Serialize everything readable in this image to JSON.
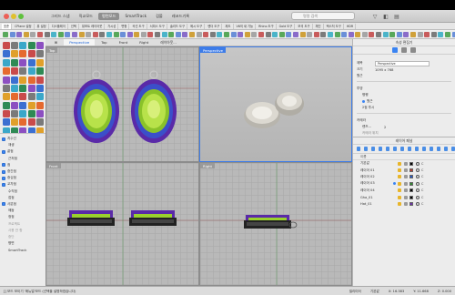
{
  "window": {
    "mode_tabs": [
      "그리드 스냅",
      "직교모드",
      "평면모드",
      "SmartTrack",
      "검볼",
      "레코드기록"
    ],
    "active_mode_index": 2,
    "search_placeholder": "명령 검색"
  },
  "toolbar_tabs": [
    "표준",
    "CPlane 설정",
    "뷰 설정",
    "디스플레이",
    "선택",
    "뷰포트 레이아웃",
    "가시성",
    "변형",
    "곡선 도구",
    "서피스 도구",
    "솔리드 도구",
    "메시 도구",
    "렌더 도구",
    "제도",
    "V6의 새 기능",
    "Rhino 도구",
    "Gold 도구",
    "보석 도구",
    "체인",
    "텍스처 도구",
    "HDR"
  ],
  "active_toolbar_tab_index": 0,
  "viewport_tabs": [
    "Perspective",
    "Top",
    "Front",
    "Right",
    "레이아웃..."
  ],
  "active_viewport_tab_index": 0,
  "viewports": {
    "top": "Top",
    "perspective": "Perspective",
    "front": "Front",
    "right": "Right"
  },
  "left_panel": {
    "items": [
      {
        "label": "치수선",
        "checked": true,
        "indent": false,
        "dim": false
      },
      {
        "label": "재생",
        "checked": false,
        "indent": true,
        "dim": false
      },
      {
        "label": "끝점",
        "checked": true,
        "indent": false,
        "dim": false
      },
      {
        "label": "근처점",
        "checked": false,
        "indent": true,
        "dim": false
      },
      {
        "label": "점",
        "checked": true,
        "indent": false,
        "dim": false
      },
      {
        "label": "중간점",
        "checked": true,
        "indent": false,
        "dim": false
      },
      {
        "label": "중심점",
        "checked": true,
        "indent": false,
        "dim": false
      },
      {
        "label": "교차점",
        "checked": true,
        "indent": false,
        "dim": false
      },
      {
        "label": "수직점",
        "checked": false,
        "indent": true,
        "dim": false
      },
      {
        "label": "접점",
        "checked": false,
        "indent": true,
        "dim": false
      },
      {
        "label": "사분점",
        "checked": true,
        "indent": false,
        "dim": false
      },
      {
        "label": "매듭",
        "checked": false,
        "indent": true,
        "dim": false
      },
      {
        "label": "정점",
        "checked": false,
        "indent": true,
        "dim": false
      },
      {
        "label": "프로젝트",
        "checked": false,
        "indent": true,
        "dim": true
      },
      {
        "label": "사용 안 함",
        "checked": false,
        "indent": true,
        "dim": true
      },
      {
        "label": "중단",
        "checked": false,
        "indent": true,
        "dim": true
      },
      {
        "label": "평면",
        "checked": false,
        "indent": true,
        "dim": false
      },
      {
        "label": "SmartTrack",
        "checked": false,
        "indent": true,
        "dim": false
      }
    ]
  },
  "properties": {
    "title": "속성 편집기",
    "name_label": "제목",
    "name_value": "Perspective",
    "size_label": "크기",
    "size_value": "1095 x 768",
    "projection_label": "원근",
    "section_view": "투영",
    "opt_parallel": "평행",
    "opt_perspective": "원근",
    "opt_2pt": "2점 투시",
    "section_camera": "카메라",
    "lens_label": "렌즈...",
    "lens_value": "2",
    "target_label": "카메라 위치"
  },
  "layers": {
    "title": "레이어 패널",
    "col_name": "이름",
    "rows": [
      {
        "name": "기본값",
        "current": false,
        "color": "#000000",
        "c": "C"
      },
      {
        "name": "레이어 01",
        "current": false,
        "color": "#c0392b",
        "c": "C"
      },
      {
        "name": "레이어 02",
        "current": false,
        "color": "#2457c5",
        "c": "C"
      },
      {
        "name": "레이어 03",
        "current": true,
        "color": "#2e8a2e",
        "c": "C"
      },
      {
        "name": "레이어 04",
        "current": false,
        "color": "#000000",
        "c": "C"
      },
      {
        "name": "Gha_01",
        "current": false,
        "color": "#000000",
        "c": "C"
      },
      {
        "name": "Hat_01",
        "current": false,
        "color": "#6b2fa8",
        "c": "C"
      }
    ]
  },
  "status": {
    "command_hint": "[] 모드 보이기 '매뉴얼'모드 (선택을 설명하였습니다)",
    "unit": "밀리미터",
    "layer_state": "기본값",
    "x": "X: 16.383",
    "y": "Y: 11.668",
    "z": "Z: 0.000"
  },
  "colors": {
    "active_viewport": "#3d7ce8",
    "gem_green": "#a6d234",
    "prong_purple": "#6d31c9",
    "blue_stone": "#2c56d6",
    "metal": "#c9c6be"
  }
}
